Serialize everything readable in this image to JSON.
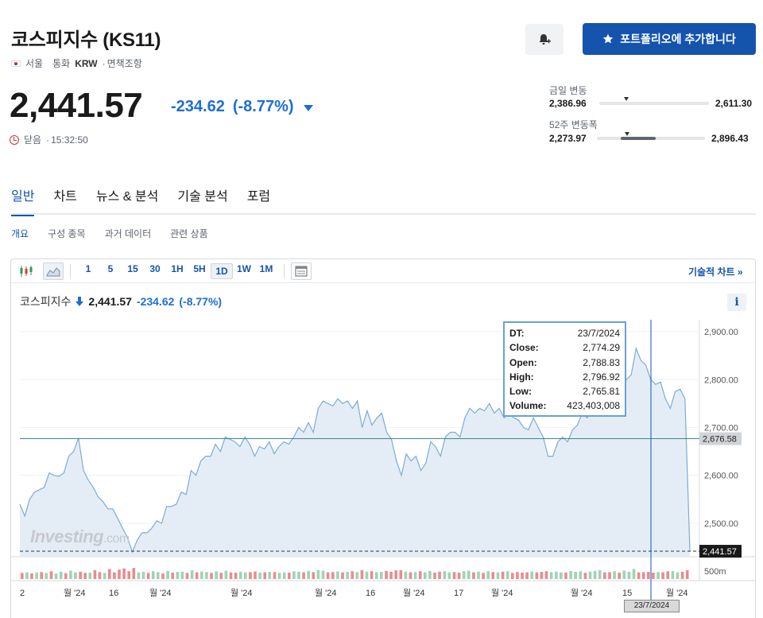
{
  "header": {
    "title": "코스피지수 (KS11)",
    "exchange": "서울",
    "currency_label": "통화",
    "currency": "KRW",
    "disclaimer": "면책조항",
    "portfolio_button": "포트폴리오에 추가합니다"
  },
  "quote": {
    "price": "2,441.57",
    "change": "-234.62",
    "change_pct": "(-8.77%)",
    "status": "닫음",
    "time": "15:32:50"
  },
  "ranges": {
    "day_label": "금일 변동",
    "day_low": "2,386.96",
    "day_high": "2,611.30",
    "week52_label": "52주 변동폭",
    "week52_low": "2,273.97",
    "week52_high": "2,896.43"
  },
  "tabs": [
    "일반",
    "차트",
    "뉴스 & 분석",
    "기술 분석",
    "포럼"
  ],
  "subtabs": [
    "개요",
    "구성 종목",
    "과거 데이터",
    "관련 상품"
  ],
  "toolbar": {
    "intervals": [
      "1",
      "5",
      "15",
      "30",
      "1H",
      "5H",
      "1D",
      "1W",
      "1M"
    ],
    "selected": "1D",
    "tech_chart_link": "기술적 차트 »"
  },
  "chart_legend": {
    "name": "코스피지수",
    "price": "2,441.57",
    "change": "-234.62",
    "change_pct": "(-8.77%)",
    "info": "i"
  },
  "tooltip": {
    "rows": [
      {
        "k": "DT:",
        "v": "23/7/2024"
      },
      {
        "k": "Close:",
        "v": "2,774.29"
      },
      {
        "k": "Open:",
        "v": "2,788.83"
      },
      {
        "k": "High:",
        "v": "2,796.92"
      },
      {
        "k": "Low:",
        "v": "2,765.81"
      },
      {
        "k": "Volume:",
        "v": "423,403,008"
      }
    ]
  },
  "watermark": {
    "brand": "Investing",
    "suffix": ".com"
  },
  "colors": {
    "accent": "#1554ad",
    "down": "#1e6ed1",
    "line": "#7eaad6",
    "area": "#e4edf6",
    "vol_up": "#9fd3b4",
    "vol_down": "#e98c8c"
  },
  "chart_data": {
    "type": "area",
    "y_ticks": [
      "2,900.00",
      "2,800.00",
      "2,700.00",
      "2,600.00",
      "2,500.00"
    ],
    "ylim": [
      2430,
      2925
    ],
    "prev_close_tag": "2,676.58",
    "prev_close": 2676.58,
    "last_tag": "2,441.57",
    "last": 2441.57,
    "volume_tick": "500m",
    "x_labels": [
      "2",
      "월 '24",
      "16",
      "월 '24",
      "월 '24",
      "월 '24",
      "16",
      "월 '24",
      "17",
      "월 '24",
      "월 '24",
      "15",
      "월 '24"
    ],
    "crosshair_date": "23/7/2024",
    "values": [
      2540,
      2515,
      2550,
      2565,
      2570,
      2575,
      2605,
      2600,
      2598,
      2605,
      2640,
      2650,
      2678,
      2610,
      2590,
      2575,
      2555,
      2545,
      2530,
      2530,
      2510,
      2490,
      2470,
      2440,
      2465,
      2480,
      2480,
      2490,
      2505,
      2500,
      2535,
      2535,
      2540,
      2565,
      2560,
      2610,
      2600,
      2630,
      2640,
      2640,
      2665,
      2650,
      2680,
      2675,
      2670,
      2660,
      2680,
      2665,
      2640,
      2660,
      2655,
      2670,
      2645,
      2660,
      2670,
      2665,
      2680,
      2700,
      2690,
      2710,
      2690,
      2740,
      2755,
      2750,
      2745,
      2760,
      2750,
      2755,
      2740,
      2755,
      2700,
      2735,
      2705,
      2720,
      2730,
      2690,
      2675,
      2630,
      2600,
      2645,
      2630,
      2640,
      2610,
      2625,
      2670,
      2660,
      2640,
      2680,
      2690,
      2690,
      2680,
      2720,
      2740,
      2730,
      2740,
      2735,
      2750,
      2730,
      2740,
      2720,
      2730,
      2720,
      2715,
      2700,
      2695,
      2720,
      2700,
      2680,
      2640,
      2640,
      2670,
      2680,
      2670,
      2695,
      2705,
      2730,
      2720,
      2740,
      2760,
      2790,
      2780,
      2760,
      2780,
      2770,
      2800,
      2810,
      2865,
      2840,
      2830,
      2800,
      2790,
      2795,
      2760,
      2740,
      2775,
      2780,
      2760,
      2441.57
    ],
    "volume": [
      {
        "v": 0.55,
        "u": false
      },
      {
        "v": 0.6,
        "u": true
      },
      {
        "v": 0.5,
        "u": false
      },
      {
        "v": 0.58,
        "u": true
      },
      {
        "v": 0.62,
        "u": false
      },
      {
        "v": 0.55,
        "u": true
      },
      {
        "v": 0.7,
        "u": false
      },
      {
        "v": 0.5,
        "u": true
      },
      {
        "v": 0.65,
        "u": true
      },
      {
        "v": 0.52,
        "u": false
      },
      {
        "v": 0.75,
        "u": true
      },
      {
        "v": 0.6,
        "u": true
      },
      {
        "v": 0.66,
        "u": false
      },
      {
        "v": 0.55,
        "u": false
      },
      {
        "v": 0.58,
        "u": true
      },
      {
        "v": 0.8,
        "u": false
      },
      {
        "v": 0.62,
        "u": false
      },
      {
        "v": 0.55,
        "u": true
      },
      {
        "v": 0.9,
        "u": false
      },
      {
        "v": 0.6,
        "u": false
      },
      {
        "v": 0.85,
        "u": false
      },
      {
        "v": 0.95,
        "u": false
      },
      {
        "v": 0.7,
        "u": false
      },
      {
        "v": 1.0,
        "u": false
      },
      {
        "v": 0.6,
        "u": true
      },
      {
        "v": 0.65,
        "u": true
      },
      {
        "v": 0.55,
        "u": false
      },
      {
        "v": 0.7,
        "u": true
      },
      {
        "v": 0.62,
        "u": true
      },
      {
        "v": 0.5,
        "u": false
      },
      {
        "v": 0.72,
        "u": true
      },
      {
        "v": 0.58,
        "u": false
      },
      {
        "v": 0.64,
        "u": true
      },
      {
        "v": 0.66,
        "u": true
      },
      {
        "v": 0.55,
        "u": false
      },
      {
        "v": 0.78,
        "u": true
      },
      {
        "v": 0.6,
        "u": false
      },
      {
        "v": 0.68,
        "u": true
      },
      {
        "v": 0.62,
        "u": true
      },
      {
        "v": 0.55,
        "u": false
      },
      {
        "v": 0.7,
        "u": true
      },
      {
        "v": 0.56,
        "u": false
      },
      {
        "v": 0.74,
        "u": true
      },
      {
        "v": 0.6,
        "u": false
      },
      {
        "v": 0.58,
        "u": false
      },
      {
        "v": 0.66,
        "u": true
      },
      {
        "v": 0.6,
        "u": true
      },
      {
        "v": 0.62,
        "u": false
      },
      {
        "v": 0.68,
        "u": false
      },
      {
        "v": 0.58,
        "u": true
      },
      {
        "v": 0.6,
        "u": false
      },
      {
        "v": 0.64,
        "u": true
      },
      {
        "v": 0.62,
        "u": false
      },
      {
        "v": 0.55,
        "u": true
      },
      {
        "v": 0.6,
        "u": true
      },
      {
        "v": 0.58,
        "u": false
      },
      {
        "v": 0.7,
        "u": true
      },
      {
        "v": 0.66,
        "u": true
      },
      {
        "v": 0.6,
        "u": false
      },
      {
        "v": 0.72,
        "u": true
      },
      {
        "v": 0.62,
        "u": false
      },
      {
        "v": 0.8,
        "u": true
      },
      {
        "v": 0.75,
        "u": true
      },
      {
        "v": 0.6,
        "u": false
      },
      {
        "v": 0.62,
        "u": false
      },
      {
        "v": 0.68,
        "u": true
      },
      {
        "v": 0.6,
        "u": false
      },
      {
        "v": 0.64,
        "u": true
      },
      {
        "v": 0.7,
        "u": false
      },
      {
        "v": 0.62,
        "u": true
      },
      {
        "v": 0.8,
        "u": false
      },
      {
        "v": 0.66,
        "u": true
      },
      {
        "v": 0.7,
        "u": false
      },
      {
        "v": 0.62,
        "u": true
      },
      {
        "v": 0.64,
        "u": true
      },
      {
        "v": 0.72,
        "u": false
      },
      {
        "v": 0.66,
        "u": false
      },
      {
        "v": 0.78,
        "u": false
      },
      {
        "v": 0.8,
        "u": false
      },
      {
        "v": 0.66,
        "u": true
      },
      {
        "v": 0.6,
        "u": false
      },
      {
        "v": 0.62,
        "u": true
      },
      {
        "v": 0.7,
        "u": false
      },
      {
        "v": 0.6,
        "u": true
      },
      {
        "v": 0.72,
        "u": true
      },
      {
        "v": 0.58,
        "u": false
      },
      {
        "v": 0.66,
        "u": false
      },
      {
        "v": 0.7,
        "u": true
      },
      {
        "v": 0.6,
        "u": true
      },
      {
        "v": 0.62,
        "u": false
      },
      {
        "v": 0.58,
        "u": false
      },
      {
        "v": 0.7,
        "u": true
      },
      {
        "v": 0.74,
        "u": true
      },
      {
        "v": 0.6,
        "u": false
      },
      {
        "v": 0.66,
        "u": true
      },
      {
        "v": 0.56,
        "u": false
      },
      {
        "v": 0.7,
        "u": true
      },
      {
        "v": 0.62,
        "u": false
      },
      {
        "v": 0.6,
        "u": true
      },
      {
        "v": 0.66,
        "u": false
      },
      {
        "v": 0.7,
        "u": true
      },
      {
        "v": 0.56,
        "u": false
      },
      {
        "v": 0.62,
        "u": false
      },
      {
        "v": 0.58,
        "u": false
      },
      {
        "v": 0.6,
        "u": false
      },
      {
        "v": 0.68,
        "u": true
      },
      {
        "v": 0.6,
        "u": false
      },
      {
        "v": 0.64,
        "u": false
      },
      {
        "v": 0.7,
        "u": false
      },
      {
        "v": 0.62,
        "u": true
      },
      {
        "v": 0.66,
        "u": true
      },
      {
        "v": 0.6,
        "u": true
      },
      {
        "v": 0.58,
        "u": false
      },
      {
        "v": 0.72,
        "u": true
      },
      {
        "v": 0.64,
        "u": true
      },
      {
        "v": 0.7,
        "u": true
      },
      {
        "v": 0.56,
        "u": false
      },
      {
        "v": 0.66,
        "u": true
      },
      {
        "v": 0.72,
        "u": true
      },
      {
        "v": 0.8,
        "u": true
      },
      {
        "v": 0.6,
        "u": false
      },
      {
        "v": 0.62,
        "u": false
      },
      {
        "v": 0.7,
        "u": true
      },
      {
        "v": 0.58,
        "u": false
      },
      {
        "v": 0.76,
        "u": true
      },
      {
        "v": 0.66,
        "u": true
      },
      {
        "v": 0.9,
        "u": true
      },
      {
        "v": 0.6,
        "u": false
      },
      {
        "v": 0.62,
        "u": false
      },
      {
        "v": 0.64,
        "u": false
      },
      {
        "v": 0.58,
        "u": false
      },
      {
        "v": 0.62,
        "u": true
      },
      {
        "v": 0.6,
        "u": false
      },
      {
        "v": 0.7,
        "u": false
      },
      {
        "v": 0.72,
        "u": true
      },
      {
        "v": 0.6,
        "u": true
      },
      {
        "v": 0.66,
        "u": false
      },
      {
        "v": 0.8,
        "u": false
      }
    ]
  }
}
